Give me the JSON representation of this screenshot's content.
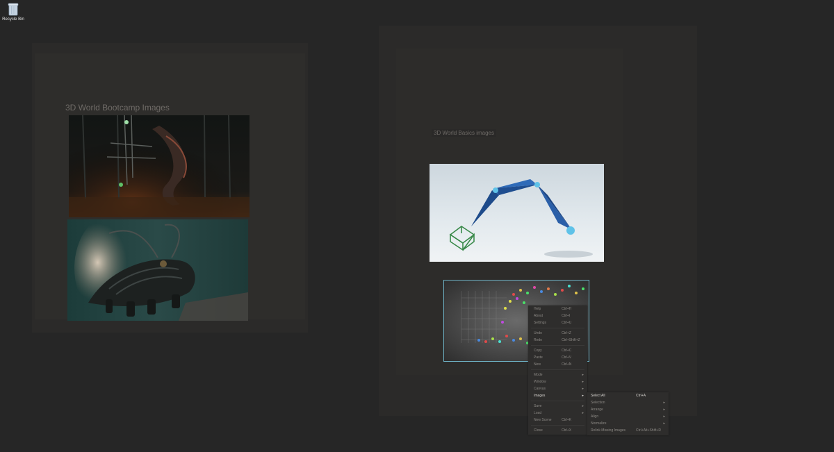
{
  "desktop": {
    "recycle_bin_label": "Recycle Bin"
  },
  "boards": {
    "left_title": "3D World Bootcamp Images",
    "right_title": "3D World Basics images"
  },
  "context_menu": {
    "items": [
      {
        "label": "Help",
        "shortcut": "Ctrl+H"
      },
      {
        "label": "About",
        "shortcut": "Ctrl+I"
      },
      {
        "label": "Settings",
        "shortcut": "Ctrl+U"
      },
      {
        "label": "Undo",
        "shortcut": "Ctrl+Z"
      },
      {
        "label": "Redo",
        "shortcut": "Ctrl+Shift+Z"
      },
      {
        "label": "Copy",
        "shortcut": "Ctrl+C"
      },
      {
        "label": "Paste",
        "shortcut": "Ctrl+V"
      },
      {
        "label": "New",
        "shortcut": "Ctrl+N"
      },
      {
        "label": "Mode",
        "shortcut": ""
      },
      {
        "label": "Window",
        "shortcut": ""
      },
      {
        "label": "Canvas",
        "shortcut": ""
      },
      {
        "label": "Images",
        "shortcut": ""
      },
      {
        "label": "Save",
        "shortcut": ""
      },
      {
        "label": "Load",
        "shortcut": ""
      },
      {
        "label": "New Scene",
        "shortcut": "Ctrl+K"
      },
      {
        "label": "Close",
        "shortcut": "Ctrl+X"
      }
    ],
    "submenu": [
      {
        "label": "Select All",
        "shortcut": "Ctrl+A"
      },
      {
        "label": "Selection",
        "shortcut": ""
      },
      {
        "label": "Arrange",
        "shortcut": ""
      },
      {
        "label": "Align",
        "shortcut": ""
      },
      {
        "label": "Normalize",
        "shortcut": ""
      },
      {
        "label": "Relink Missing Images",
        "shortcut": "Ctrl+Alt+Shift+R"
      }
    ],
    "submenu_arrow": "▸"
  },
  "colors": {
    "desktop_bg": "#262626",
    "board_bg": "#2b2a29",
    "selection_outline": "#6fb4c7",
    "menu_bg": "#2e2d2c"
  },
  "icons": [
    "recycle-bin-icon",
    "submenu-arrow-icon"
  ]
}
